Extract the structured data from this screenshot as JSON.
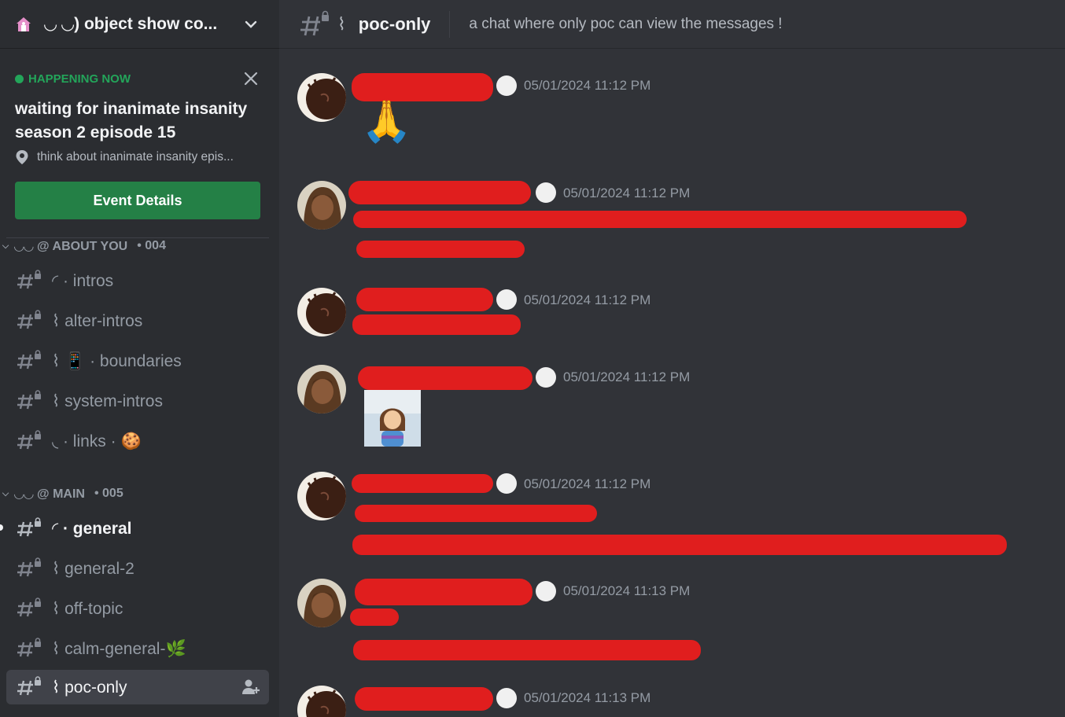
{
  "server": {
    "name": "◡ ◡) object show co...",
    "home_icon": "house-emoji-icon"
  },
  "event": {
    "status": "HAPPENING NOW",
    "title": "waiting for inanimate insanity season 2 episode 15",
    "location": "think about inanimate insanity epis...",
    "button_label": "Event Details"
  },
  "categories": [
    {
      "label": "◡◡ @ ABOUT YOU",
      "count": "• 004"
    },
    {
      "label": "◡◡ @ MAIN",
      "count": "• 005"
    }
  ],
  "channels_about": [
    {
      "label": "◜ · intros"
    },
    {
      "label": "⌇ alter-intros"
    },
    {
      "label": "⌇  📱 · boundaries"
    },
    {
      "label": "⌇ system-intros"
    },
    {
      "label": "◟ · links ·  🍪"
    }
  ],
  "channels_main": [
    {
      "label": "◜ · general",
      "state": "unread"
    },
    {
      "label": "⌇ general-2"
    },
    {
      "label": "⌇ off-topic"
    },
    {
      "label": "⌇ calm-general-🌿"
    },
    {
      "label": "⌇ poc-only",
      "state": "active"
    }
  ],
  "topbar": {
    "channel_name": "poc-only",
    "topic": "a chat where only poc can view the messages !"
  },
  "messages": [
    {
      "timestamp": "05/01/2024 11:12 PM",
      "content": "🙏"
    },
    {
      "timestamp": "05/01/2024 11:12 PM"
    },
    {
      "timestamp": "05/01/2024 11:12 PM"
    },
    {
      "timestamp": "05/01/2024 11:12 PM"
    },
    {
      "timestamp": "05/01/2024 11:12 PM"
    },
    {
      "timestamp": "05/01/2024 11:13 PM"
    },
    {
      "timestamp": "05/01/2024 11:13 PM"
    }
  ],
  "colors": {
    "sidebar_bg": "#2b2d31",
    "main_bg": "#313338",
    "happening_green": "#23a55a",
    "button_green": "#248046",
    "redaction_red": "#e01e1e"
  }
}
